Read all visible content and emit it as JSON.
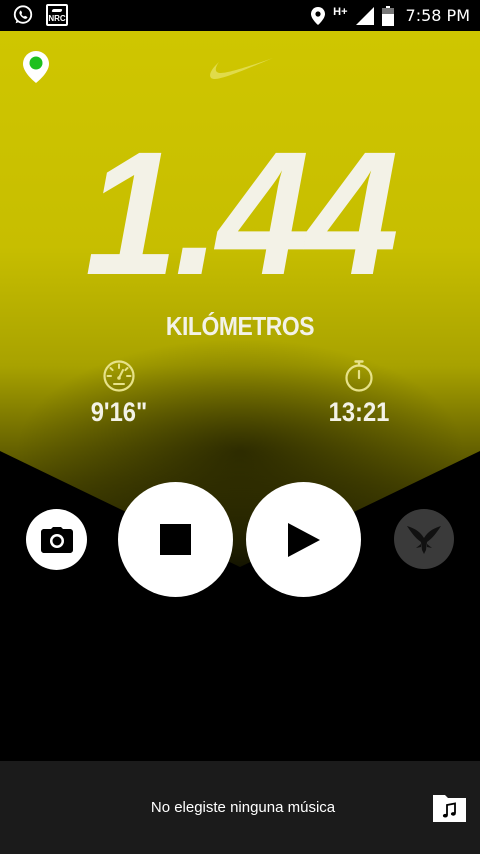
{
  "status_bar": {
    "left_icons": [
      "whatsapp-icon",
      "nrc-icon"
    ],
    "nrc_label": "NRC",
    "network": "H+",
    "time": "7:58 PM"
  },
  "run": {
    "distance": "1.44",
    "distance_unit": "KILÓMETROS",
    "pace": "9'16\"",
    "duration": "13:21"
  },
  "controls": {
    "camera": "camera-icon",
    "stop": "stop-icon",
    "play": "play-icon",
    "cheer": "cheer-icon"
  },
  "music": {
    "label": "No elegiste ninguna música",
    "icon": "music-folder-icon"
  },
  "colors": {
    "accent_yellow": "#cfc600",
    "text_light": "#f3f2e7",
    "gps_green": "#1ec01e",
    "background": "#000000"
  }
}
